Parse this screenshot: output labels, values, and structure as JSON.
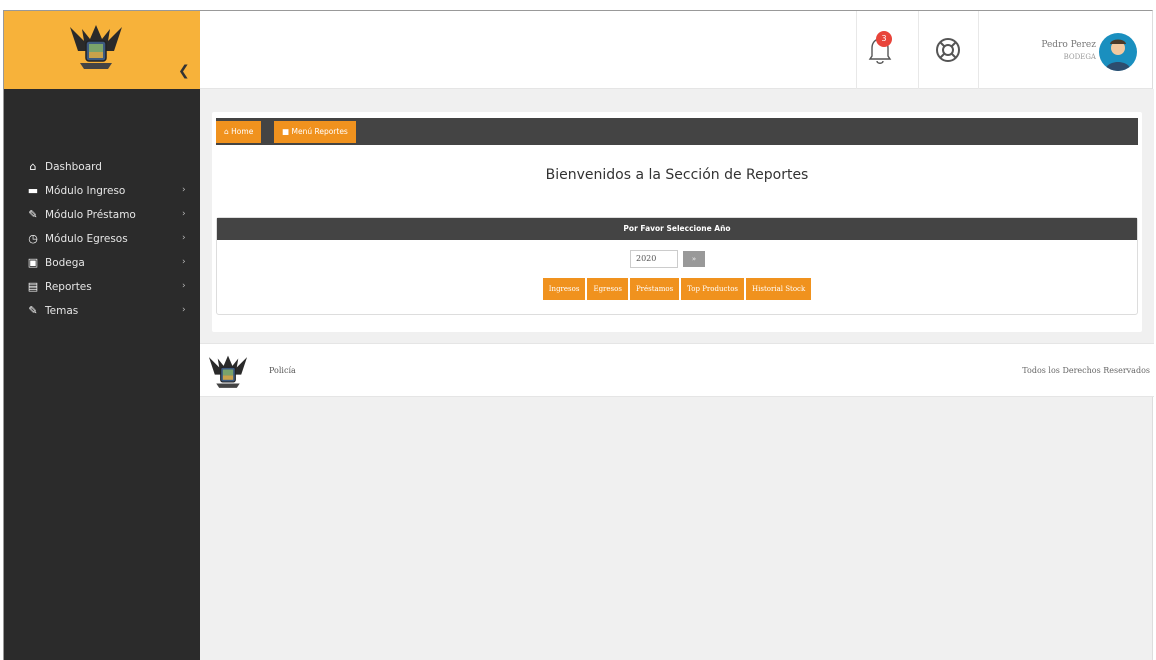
{
  "header": {
    "notification_count": "3",
    "user_name": "Pedro Perez",
    "user_role": "BODEGA"
  },
  "sidebar": {
    "items": [
      {
        "label": "Dashboard",
        "icon": "home-icon",
        "has_submenu": false
      },
      {
        "label": "Módulo Ingreso",
        "icon": "folder-icon",
        "has_submenu": true
      },
      {
        "label": "Módulo Préstamo",
        "icon": "brush-icon",
        "has_submenu": true
      },
      {
        "label": "Módulo Egresos",
        "icon": "clock-icon",
        "has_submenu": true
      },
      {
        "label": "Bodega",
        "icon": "briefcase-icon",
        "has_submenu": true
      },
      {
        "label": "Reportes",
        "icon": "table-icon",
        "has_submenu": true
      },
      {
        "label": "Temas",
        "icon": "brush-icon",
        "has_submenu": true
      }
    ]
  },
  "breadcrumb": {
    "home": "Home",
    "current": "Menú Reportes"
  },
  "main": {
    "welcome": "Bienvenidos a la Sección de Reportes",
    "year_header": "Por Favor Seleccione Año",
    "year_value": "2020",
    "year_button": "»",
    "report_buttons": [
      "Ingresos",
      "Egresos",
      "Préstamos",
      "Top Productos",
      "Historial Stock"
    ]
  },
  "footer": {
    "left": "Policía",
    "right": "Todos los Derechos Reservados"
  },
  "colors": {
    "accent": "#f0921e",
    "logo_bg": "#f7b23a",
    "sidebar_bg": "#2b2b2b",
    "dark_bar": "#444444"
  }
}
